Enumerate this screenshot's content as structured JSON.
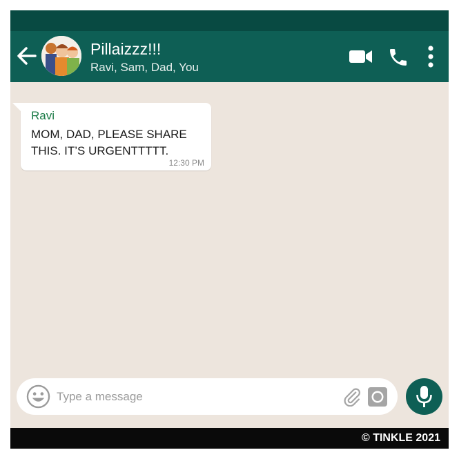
{
  "header": {
    "title": "Pillaizzz!!!",
    "members": "Ravi, Sam, Dad, You"
  },
  "icons": {
    "back": "arrow-left-icon",
    "avatar": "group-avatar",
    "video": "video-camera-icon",
    "call": "phone-icon",
    "menu": "more-vertical-icon",
    "emoji": "emoji-icon",
    "attach": "paperclip-icon",
    "camera": "camera-icon",
    "mic": "microphone-icon"
  },
  "messages": [
    {
      "sender": "Ravi",
      "text": "MOM, DAD, PLEASE SHARE THIS. IT’S URGENTTTTT.",
      "time": "12:30 PM"
    }
  ],
  "composer": {
    "placeholder": "Type a message"
  },
  "footer": {
    "copyright": "© TINKLE 2021"
  },
  "colors": {
    "header": "#0e5f55",
    "statusbar": "#084a42",
    "chat_background": "#ede5dd",
    "sender_name": "#1a7a46",
    "footer": "#0a0a0a"
  }
}
